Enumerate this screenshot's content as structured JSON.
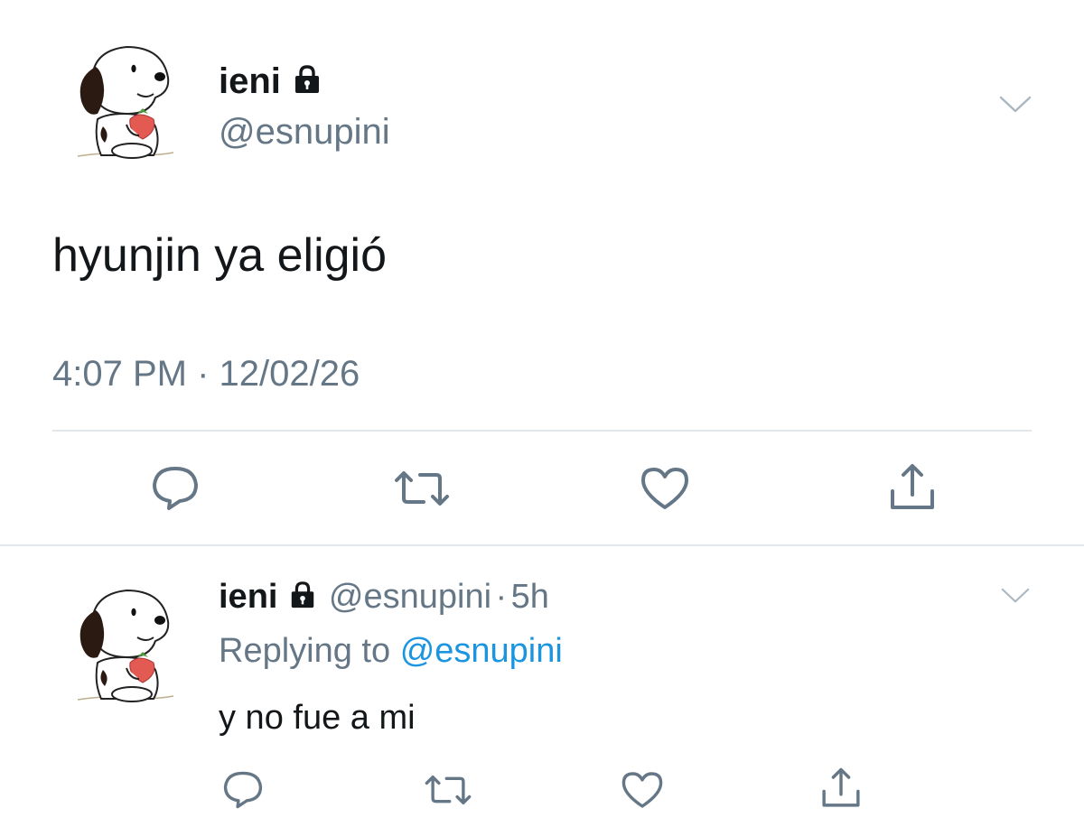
{
  "main_tweet": {
    "display_name": "ieni",
    "handle": "@esnupini",
    "text": "hyunjin ya eligió",
    "time": "4:07 PM",
    "separator": "·",
    "date": "12/02/26",
    "avatar_icon": "snoopy-avatar-icon",
    "lock_icon": "lock-icon"
  },
  "reply_tweet": {
    "display_name": "ieni",
    "handle": "@esnupini",
    "separator": "·",
    "age": "5h",
    "replying_label": "Replying to",
    "replying_handle": "@esnupini",
    "text": "y no fue a mi",
    "avatar_icon": "snoopy-avatar-icon",
    "lock_icon": "lock-icon"
  },
  "actions": [
    "reply-icon",
    "retweet-icon",
    "like-icon",
    "share-icon"
  ],
  "colors": {
    "text": "#14171a",
    "secondary": "#657786",
    "link": "#1b95e0",
    "icon": "#657786",
    "divider": "#e1e8ed"
  }
}
